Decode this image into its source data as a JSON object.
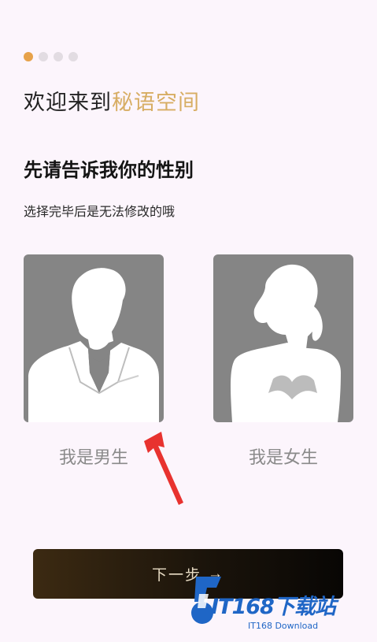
{
  "progress": {
    "total": 4,
    "current": 1
  },
  "welcome": {
    "prefix": "欢迎来到",
    "brand": "秘语空间"
  },
  "heading": "先请告诉我你的性别",
  "subheading": "选择完毕后是无法修改的哦",
  "options": {
    "male": {
      "label": "我是男生"
    },
    "female": {
      "label": "我是女生"
    }
  },
  "next_button": {
    "label": "下一步",
    "arrow": "→"
  },
  "watermark": {
    "main": "IT168下载站",
    "sub": "IT168 Download"
  },
  "colors": {
    "accent": "#e7a24a",
    "brand": "#d7ad63",
    "arrow": "#e8322f",
    "watermark": "#1f66c6"
  }
}
